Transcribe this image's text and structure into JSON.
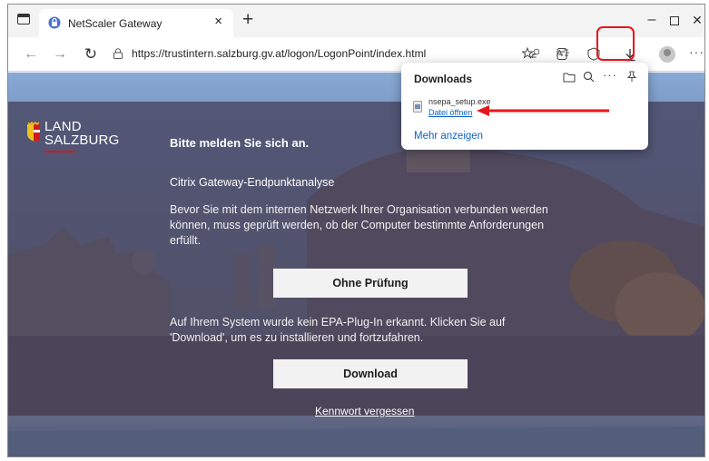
{
  "browser": {
    "tab_title": "NetScaler Gateway",
    "tab_close": "×",
    "new_tab": "+",
    "url": "https://trustintern.salzburg.gv.at/logon/LogonPoint/index.html",
    "window_controls": {
      "minimize": "–",
      "close": "✕"
    },
    "more_menu": "···",
    "icons": [
      "tab-actions-icon",
      "back-icon",
      "forward-icon",
      "reload-icon",
      "lock-icon",
      "key-icon",
      "read-aloud-icon",
      "favorites-icon",
      "collections-icon",
      "download-icon",
      "profile-icon",
      "more-icon"
    ]
  },
  "downloads_panel": {
    "title": "Downloads",
    "file_name": "nsepa_setup.exe",
    "file_action": "Datei öffnen",
    "more_link": "Mehr anzeigen"
  },
  "page": {
    "logo_line1": "LAND",
    "logo_line2": "SALZBURG",
    "heading": "Bitte melden Sie sich an.",
    "subtitle": "Citrix Gateway-Endpunktanalyse",
    "paragraph1": "Bevor Sie mit dem internen Netzwerk Ihrer Organisation verbunden werden können, muss geprüft werden, ob der Computer bestimmte Anforderungen erfüllt.",
    "button_skip": "Ohne Prüfung",
    "paragraph2": "Auf Ihrem System wurde kein EPA-Plug-In erkannt. Klicken Sie auf 'Download', um es zu installieren und fortzufahren.",
    "button_download": "Download",
    "forgot_password": "Kennwort vergessen"
  },
  "colors": {
    "annotation_red": "#e8151b",
    "link_blue": "#0b63c4",
    "logo_red": "#d21a1a"
  }
}
